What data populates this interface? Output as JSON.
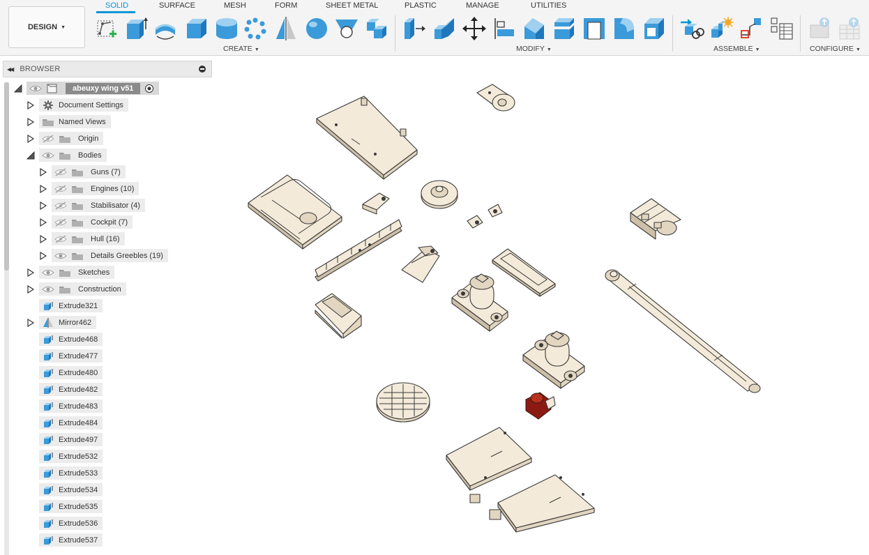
{
  "workspace": {
    "label": "DESIGN"
  },
  "tabs": [
    {
      "label": "SOLID",
      "active": true
    },
    {
      "label": "SURFACE"
    },
    {
      "label": "MESH"
    },
    {
      "label": "FORM"
    },
    {
      "label": "SHEET METAL"
    },
    {
      "label": "PLASTIC"
    },
    {
      "label": "MANAGE"
    },
    {
      "label": "UTILITIES"
    }
  ],
  "groups": {
    "create": "CREATE",
    "modify": "MODIFY",
    "assemble": "ASSEMBLE",
    "configure": "CONFIGURE"
  },
  "tools": {
    "create": [
      "create-sketch-icon",
      "extrude-icon",
      "revolve-icon",
      "box-icon",
      "cylinder-icon",
      "pattern-icon",
      "mirror-icon",
      "sphere-icon",
      "hole-icon",
      "combine-icon"
    ],
    "modify": [
      "press-pull-icon",
      "move-faces-icon",
      "move-copy-icon",
      "align-icon",
      "chamfer-icon",
      "offset-face-icon",
      "shell-icon",
      "fillet-icon",
      "draft-icon"
    ],
    "assemble": [
      "new-component-icon",
      "joint-icon",
      "as-built-joint-icon",
      "table-icon"
    ],
    "configure": [
      "configure-icon",
      "configure-table-icon"
    ]
  },
  "browser": {
    "title": "BROWSER",
    "root": {
      "label": "abeuxy wing v51"
    },
    "items": [
      {
        "label": "Document Settings",
        "icon": "gear-icon"
      },
      {
        "label": "Named Views",
        "icon": "folder-icon"
      },
      {
        "label": "Origin",
        "icon": "folder-icon",
        "eye": "hidden"
      },
      {
        "label": "Bodies",
        "icon": "folder-icon",
        "eye": "visible",
        "expanded": true
      },
      {
        "label": "Guns (7)",
        "icon": "folder-icon",
        "eye": "hidden"
      },
      {
        "label": "Engines (10)",
        "icon": "folder-icon",
        "eye": "hidden"
      },
      {
        "label": "Stabilisator (4)",
        "icon": "folder-icon",
        "eye": "hidden"
      },
      {
        "label": "Cockpit (7)",
        "icon": "folder-icon",
        "eye": "hidden"
      },
      {
        "label": "Hull (16)",
        "icon": "folder-icon",
        "eye": "hidden"
      },
      {
        "label": "Details Greebles (19)",
        "icon": "folder-icon",
        "eye": "visible"
      },
      {
        "label": "Sketches",
        "icon": "folder-icon",
        "eye": "visible"
      },
      {
        "label": "Construction",
        "icon": "folder-icon",
        "eye": "visible"
      },
      {
        "label": "Extrude321",
        "icon": "extrude-feature-icon"
      },
      {
        "label": "Mirror462",
        "icon": "mirror-feature-icon"
      },
      {
        "label": "Extrude468",
        "icon": "extrude-feature-icon"
      },
      {
        "label": "Extrude477",
        "icon": "extrude-feature-icon"
      },
      {
        "label": "Extrude480",
        "icon": "extrude-feature-icon"
      },
      {
        "label": "Extrude482",
        "icon": "extrude-feature-icon"
      },
      {
        "label": "Extrude483",
        "icon": "extrude-feature-icon"
      },
      {
        "label": "Extrude484",
        "icon": "extrude-feature-icon"
      },
      {
        "label": "Extrude497",
        "icon": "extrude-feature-icon"
      },
      {
        "label": "Extrude532",
        "icon": "extrude-feature-icon"
      },
      {
        "label": "Extrude533",
        "icon": "extrude-feature-icon"
      },
      {
        "label": "Extrude534",
        "icon": "extrude-feature-icon"
      },
      {
        "label": "Extrude535",
        "icon": "extrude-feature-icon"
      },
      {
        "label": "Extrude536",
        "icon": "extrude-feature-icon"
      },
      {
        "label": "Extrude537",
        "icon": "extrude-feature-icon"
      }
    ]
  },
  "colors": {
    "accent": "#0696d7",
    "part_fill": "#f3ead9",
    "part_edge": "#3a3a3a",
    "selected_part": "#8b1a12"
  }
}
